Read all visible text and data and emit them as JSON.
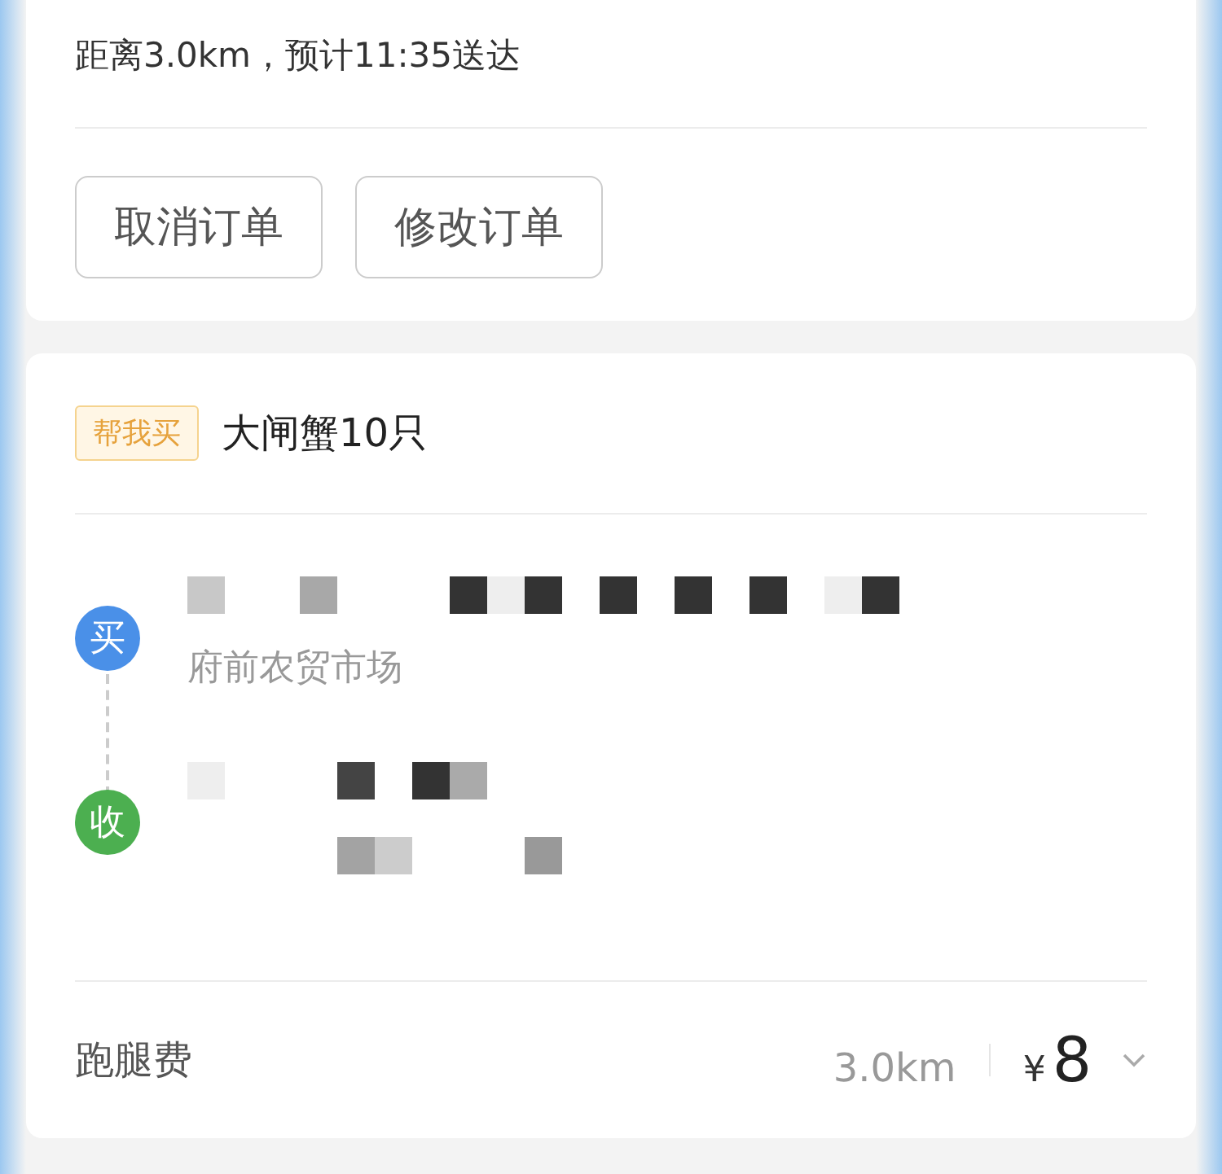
{
  "delivery_info": "距离3.0km，预计11:35送达",
  "actions": [
    {
      "label": "取消订单"
    },
    {
      "label": "修改订单"
    }
  ],
  "order": {
    "tag": "帮我买",
    "title": "大闸蟹10只"
  },
  "route": [
    {
      "kind": "buy",
      "badge": "买",
      "address": "府前农贸市场"
    },
    {
      "kind": "receive",
      "badge": "收"
    }
  ],
  "fee": {
    "label": "跑腿费",
    "distance": "3.0km",
    "currency": "¥",
    "amount": "8"
  }
}
